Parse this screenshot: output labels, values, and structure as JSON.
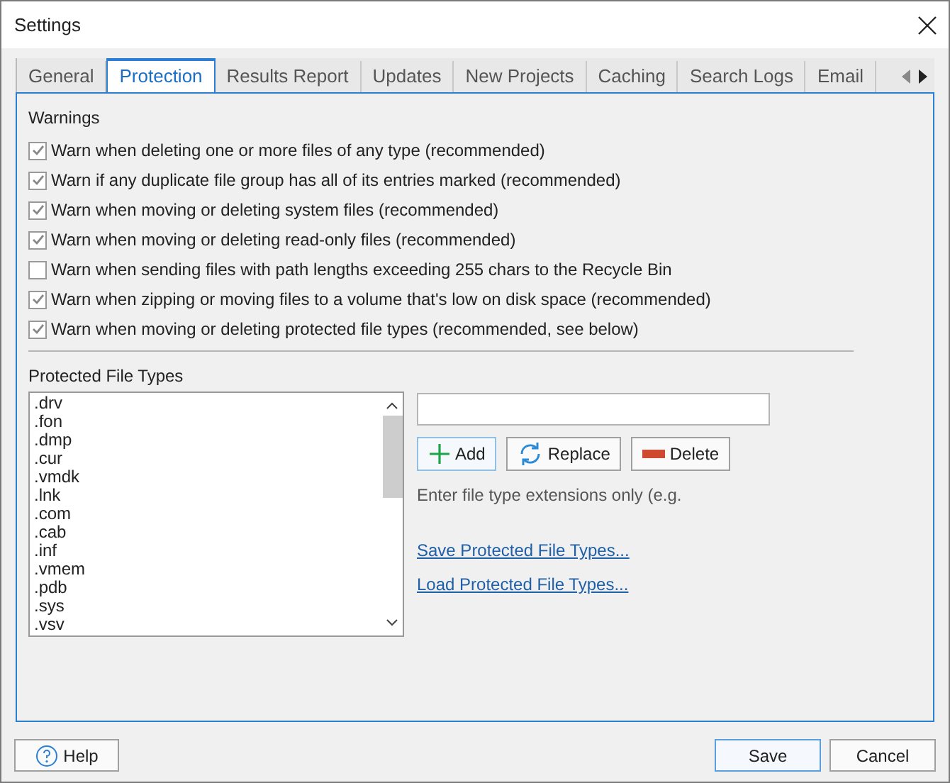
{
  "window": {
    "title": "Settings"
  },
  "tabs": [
    {
      "label": "General",
      "selected": false
    },
    {
      "label": "Protection",
      "selected": true
    },
    {
      "label": "Results Report",
      "selected": false
    },
    {
      "label": "Updates",
      "selected": false
    },
    {
      "label": "New Projects",
      "selected": false
    },
    {
      "label": "Caching",
      "selected": false
    },
    {
      "label": "Search Logs",
      "selected": false
    },
    {
      "label": "Email",
      "selected": false
    }
  ],
  "warnings": {
    "title": "Warnings",
    "items": [
      {
        "label": "Warn when deleting one or more files of any type (recommended)",
        "checked": true
      },
      {
        "label": "Warn if any duplicate file group has all of its entries marked (recommended)",
        "checked": true
      },
      {
        "label": "Warn when moving or deleting system files (recommended)",
        "checked": true
      },
      {
        "label": "Warn when moving or deleting read-only files (recommended)",
        "checked": true
      },
      {
        "label": "Warn when sending files with path lengths exceeding 255 chars to the Recycle Bin",
        "checked": false
      },
      {
        "label": "Warn when zipping or moving files to a volume that's low on disk space (recommended)",
        "checked": true
      },
      {
        "label": "Warn when moving or deleting protected file types (recommended, see below)",
        "checked": true
      }
    ]
  },
  "protected": {
    "title": "Protected File Types",
    "items": [
      ".drv",
      ".fon",
      ".dmp",
      ".cur",
      ".vmdk",
      ".lnk",
      ".com",
      ".cab",
      ".inf",
      ".vmem",
      ".pdb",
      ".sys",
      ".vsv"
    ],
    "buttons": [
      {
        "label": "Add",
        "kind": "add"
      },
      {
        "label": "Replace",
        "kind": "replace"
      },
      {
        "label": "Delete",
        "kind": "delete"
      }
    ],
    "hint": "Enter file type extensions only (e.g.",
    "links": [
      "Save Protected File Types...",
      "Load Protected File Types..."
    ]
  },
  "footer": {
    "help": "Help",
    "save": "Save",
    "cancel": "Cancel"
  }
}
